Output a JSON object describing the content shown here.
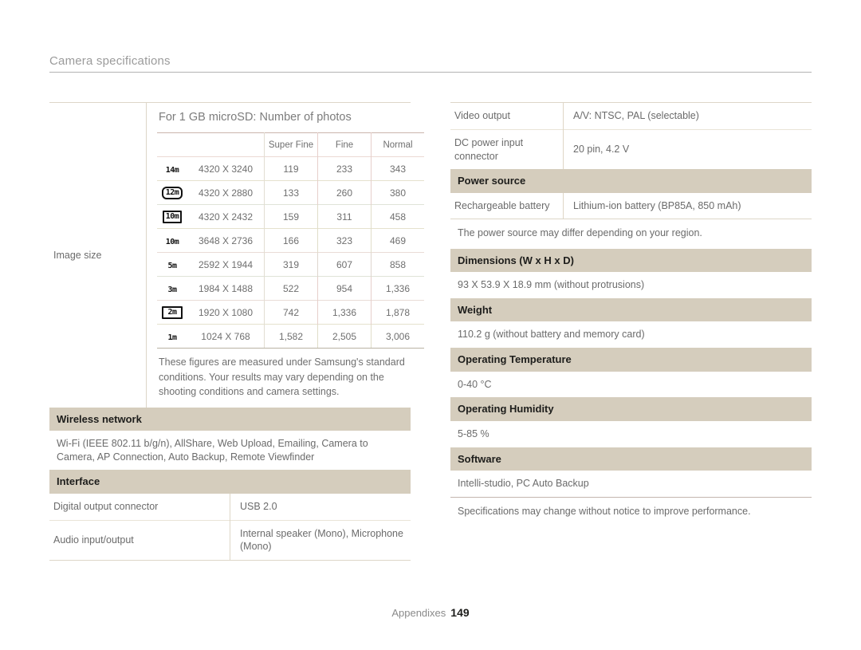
{
  "header": {
    "title": "Camera specifications"
  },
  "left": {
    "image_size_label": "Image size",
    "microsd_title": "For 1 GB microSD: Number of photos",
    "photo_table": {
      "columns": [
        "",
        "",
        "Super Fine",
        "Fine",
        "Normal"
      ],
      "rows": [
        {
          "icon": "14m",
          "icon_style": "plain",
          "dimension": "4320 X 3240",
          "super_fine": "119",
          "fine": "233",
          "normal": "343"
        },
        {
          "icon": "12m",
          "icon_style": "round",
          "dimension": "4320 X 2880",
          "super_fine": "133",
          "fine": "260",
          "normal": "380"
        },
        {
          "icon": "10m",
          "icon_style": "boxed",
          "dimension": "4320 X 2432",
          "super_fine": "159",
          "fine": "311",
          "normal": "458"
        },
        {
          "icon": "10m",
          "icon_style": "plain",
          "dimension": "3648 X 2736",
          "super_fine": "166",
          "fine": "323",
          "normal": "469"
        },
        {
          "icon": "5m",
          "icon_style": "plain",
          "dimension": "2592 X 1944",
          "super_fine": "319",
          "fine": "607",
          "normal": "858"
        },
        {
          "icon": "3m",
          "icon_style": "plain",
          "dimension": "1984 X 1488",
          "super_fine": "522",
          "fine": "954",
          "normal": "1,336"
        },
        {
          "icon": "2m",
          "icon_style": "pano",
          "dimension": "1920 X 1080",
          "super_fine": "742",
          "fine": "1,336",
          "normal": "1,878"
        },
        {
          "icon": "1m",
          "icon_style": "plain",
          "dimension": "1024 X 768",
          "super_fine": "1,582",
          "fine": "2,505",
          "normal": "3,006"
        }
      ]
    },
    "photo_note": "These figures are measured under Samsung's standard conditions. Your results may vary depending on the shooting conditions and camera settings.",
    "wireless_heading": "Wireless network",
    "wireless_value": "Wi-Fi (IEEE 802.11 b/g/n), AllShare, Web Upload, Emailing, Camera to Camera, AP Connection, Auto Backup, Remote Viewfinder",
    "interface_heading": "Interface",
    "interface_rows": [
      {
        "key": "Digital output connector",
        "value": "USB 2.0"
      },
      {
        "key": "Audio input/output",
        "value": "Internal speaker (Mono), Microphone (Mono)"
      }
    ]
  },
  "right": {
    "top_rows": [
      {
        "key": "Video output",
        "value": "A/V: NTSC, PAL (selectable)"
      },
      {
        "key": "DC power input connector",
        "value": "20 pin, 4.2 V"
      }
    ],
    "power_heading": "Power source",
    "power_rows": [
      {
        "key": "Rechargeable battery",
        "value": "Lithium-ion battery (BP85A, 850 mAh)"
      }
    ],
    "power_note": "The power source may differ depending on your region.",
    "dimensions_heading": "Dimensions (W x H x D)",
    "dimensions_value": "93 X 53.9 X 18.9 mm (without protrusions)",
    "weight_heading": "Weight",
    "weight_value": "110.2 g (without battery and memory card)",
    "op_temp_heading": "Operating Temperature",
    "op_temp_value": "0-40 °C",
    "op_humidity_heading": "Operating Humidity",
    "op_humidity_value": "5-85 %",
    "software_heading": "Software",
    "software_value": "Intelli-studio, PC Auto Backup",
    "final_note": "Specifications may change without notice to improve performance."
  },
  "footer": {
    "section": "Appendixes",
    "page": "149"
  },
  "colors": {
    "section_header_bg": "#d5cdbd",
    "text_gray": "#6b6b6b",
    "title_gray": "#9b9b9b",
    "rule": "#b3b3b3"
  }
}
